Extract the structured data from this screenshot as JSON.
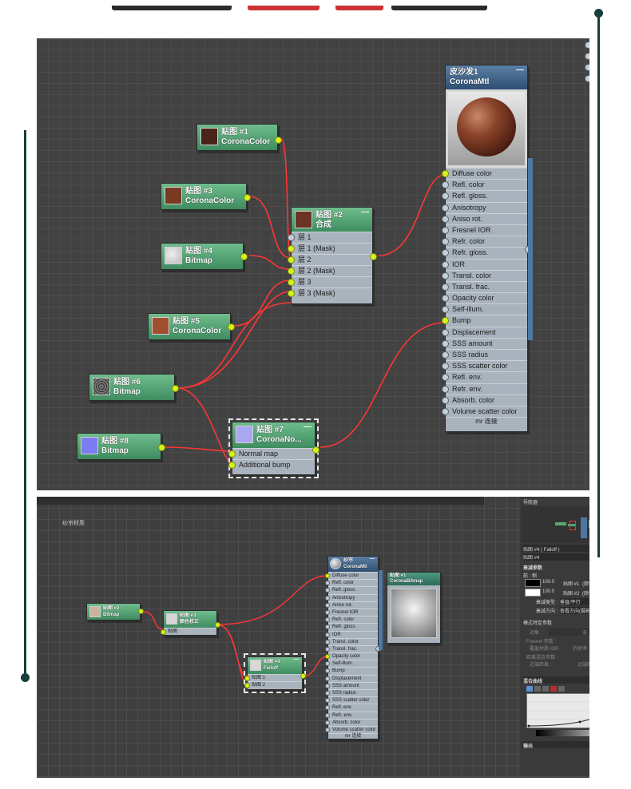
{
  "colors": {
    "accent_dark": "#16403c",
    "wire": "#ff3535",
    "port_active": "#d7f31c",
    "node_green": "#4f9f6f",
    "node_blue": "#3f5f86"
  },
  "top_panel": {
    "nodes": {
      "map1": {
        "title": "贴图 #1",
        "sub": "CoronaColor"
      },
      "map3": {
        "title": "贴图 #3",
        "sub": "CoronaColor"
      },
      "map4": {
        "title": "贴图 #4",
        "sub": "Bitmap"
      },
      "map5": {
        "title": "贴图 #5",
        "sub": "CoronaColor"
      },
      "map6": {
        "title": "贴图 #6",
        "sub": "Bitmap"
      },
      "map8": {
        "title": "贴图 #8",
        "sub": "Bitmap"
      },
      "map2": {
        "title": "贴图 #2",
        "sub": "合成",
        "slots": [
          "层 1",
          "层 1 (Mask)",
          "层 2",
          "层 2 (Mask)",
          "层 3",
          "层 3 (Mask)"
        ]
      },
      "map7": {
        "title": "贴图 #7",
        "sub": "CoronaNo...",
        "slots": [
          "Normal map",
          "Additional bump"
        ]
      },
      "mtl": {
        "title": "皮沙发1",
        "sub": "CoronaMtl",
        "footer": "mr 连接",
        "slots": [
          "Diffuse color",
          "Refl. color",
          "Refl. gloss.",
          "Anisotropy",
          "Aniso rot.",
          "Fresnel IOR",
          "Refr. color",
          "Refr. gloss.",
          "IOR",
          "Transl. color",
          "Transl. frac.",
          "Opacity color",
          "Self-illum.",
          "Bump",
          "Displacement",
          "SSS amount",
          "SSS radius",
          "SSS scatter color",
          "Refl. env.",
          "Refr. env.",
          "Absorb. color",
          "Volume scatter color"
        ]
      }
    }
  },
  "bottom_panel": {
    "label": "纱帘材质",
    "nodes": {
      "map2": {
        "title": "贴图 #2",
        "sub": "Bitmap"
      },
      "map3": {
        "title": "贴图 #3",
        "sub": "颜色校正",
        "slots": [
          "贴图"
        ]
      },
      "map4": {
        "title": "贴图 #4",
        "sub": "Falloff",
        "slots": [
          "贴图 1",
          "贴图 2"
        ]
      },
      "mtl": {
        "title": "纱帘",
        "sub": "CoronaMtl",
        "footer": "mr 连接",
        "slots": [
          "Diffuse color",
          "Refl. color",
          "Refl. gloss.",
          "Anisotropy",
          "Aniso rot.",
          "Fresnel IOR",
          "Refr. color",
          "Refr. gloss.",
          "IOR",
          "Transl. color",
          "Transl. frac.",
          "Opacity color",
          "Self-illum.",
          "Bump",
          "Displacement",
          "SSS amount",
          "SSS radius",
          "SSS scatter color",
          "Refl. env.",
          "Refr. env.",
          "Absorb. color",
          "Volume scatter color"
        ]
      },
      "map1": {
        "title": "贴图 #1",
        "sub": "CoronaBitmap"
      }
    },
    "side_panel": {
      "navigator": "导航器",
      "map_header": "贴图 #4 ( Falloff )",
      "map_name": "贴图 #4",
      "falloff_params": "衰减参数",
      "front_side": "前 : 侧",
      "row1_value": "100.0",
      "row1_map": "贴图 #1",
      "row1_mode": "(颜色校正)",
      "row2_value": "100.0",
      "row2_map": "贴图 #2",
      "row2_mode": "(颜色校正)",
      "falloff_type_label": "衰减类型 :",
      "falloff_type_value": "垂直/平行",
      "falloff_dir_label": "衰减方向 :",
      "falloff_dir_value": "查看方向(摄影机 Z 轴)",
      "mode_params": "模式特定参数",
      "object_label": "对象 :",
      "object_value": "无",
      "fresnel_params": "Fresnel 参数 :",
      "override_ior": "覆盖材质 IOR",
      "refraction": "折射率",
      "distance_blend": "距离混合参数 :",
      "near": "近端距离 :",
      "far": "远端距离 :",
      "extrapolate": "外推",
      "mix_curve": "混合曲线",
      "output": "输出"
    }
  }
}
